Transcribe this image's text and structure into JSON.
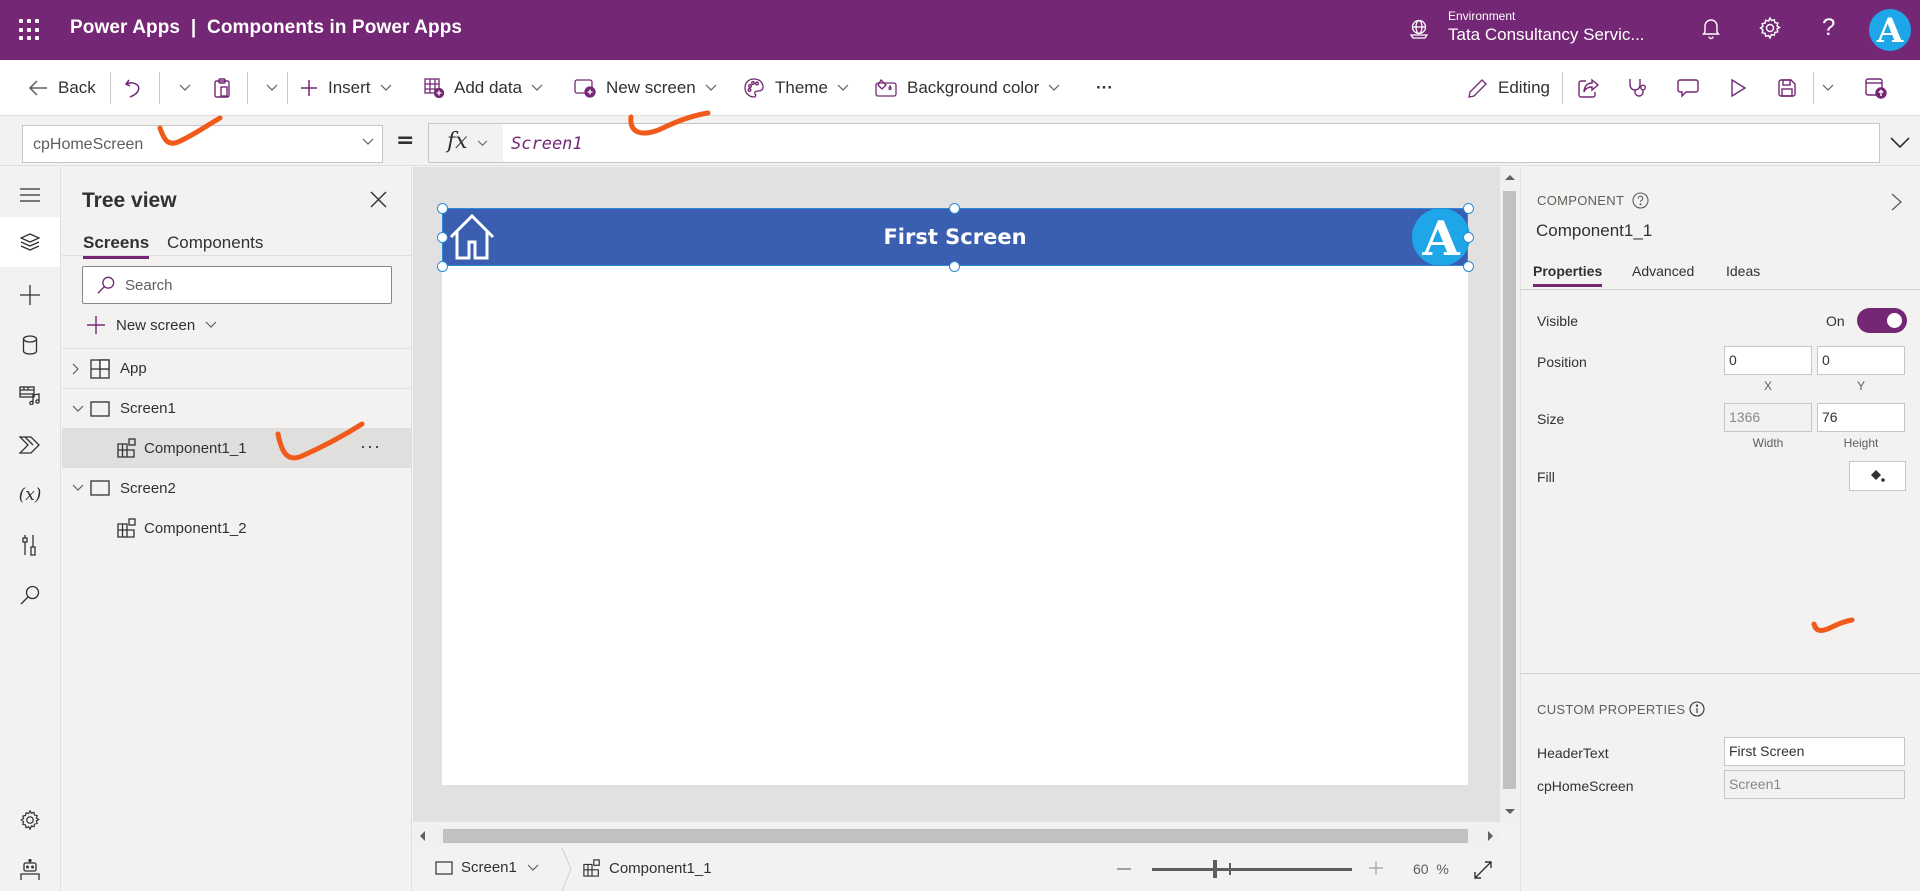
{
  "header": {
    "app_title": "Power Apps  |  Components in Power Apps",
    "environment_label": "Environment",
    "environment_name": "Tata Consultancy Servic...",
    "avatar_letter": "A"
  },
  "commandbar": {
    "back": "Back",
    "insert": "Insert",
    "add_data": "Add data",
    "new_screen": "New screen",
    "theme": "Theme",
    "background_color": "Background color",
    "more": "···",
    "editing": "Editing"
  },
  "formulabar": {
    "property": "cpHomeScreen",
    "equals": "=",
    "fx": "fx",
    "formula": "Screen1"
  },
  "treeview": {
    "title": "Tree view",
    "tabs": [
      {
        "label": "Screens",
        "active": true
      },
      {
        "label": "Components",
        "active": false
      }
    ],
    "search_placeholder": "Search",
    "new_screen": "New screen",
    "items": [
      {
        "label": "App",
        "type": "app",
        "expanded": false,
        "level": 0
      },
      {
        "label": "Screen1",
        "type": "screen",
        "expanded": true,
        "level": 0
      },
      {
        "label": "Component1_1",
        "type": "component",
        "level": 1,
        "selected": true
      },
      {
        "label": "Screen2",
        "type": "screen",
        "expanded": true,
        "level": 0
      },
      {
        "label": "Component1_2",
        "type": "component",
        "level": 1
      }
    ],
    "more_label": "···"
  },
  "canvas": {
    "header_text": "First Screen",
    "logo_letter": "A",
    "header_color": "#3a5fb0"
  },
  "statusbar": {
    "screen": "Screen1",
    "component": "Component1_1",
    "zoom_value": "60",
    "zoom_unit": "%",
    "zoom_percent": 60
  },
  "properties": {
    "kind": "COMPONENT",
    "name": "Component1_1",
    "tabs": [
      {
        "label": "Properties",
        "active": true
      },
      {
        "label": "Advanced",
        "active": false
      },
      {
        "label": "Ideas",
        "active": false
      }
    ],
    "visible_label": "Visible",
    "visible_state": "On",
    "position_label": "Position",
    "position_x": "0",
    "position_y": "0",
    "x_label": "X",
    "y_label": "Y",
    "size_label": "Size",
    "width": "1366",
    "height": "76",
    "width_label": "Width",
    "height_label": "Height",
    "fill_label": "Fill",
    "custom_header": "CUSTOM PROPERTIES",
    "custom": [
      {
        "label": "HeaderText",
        "value": "First Screen"
      },
      {
        "label": "cpHomeScreen",
        "value": "Screen1"
      }
    ]
  },
  "colors": {
    "brand": "#742774",
    "annotation": "#f05a1a",
    "selection": "#2c8ad8"
  }
}
